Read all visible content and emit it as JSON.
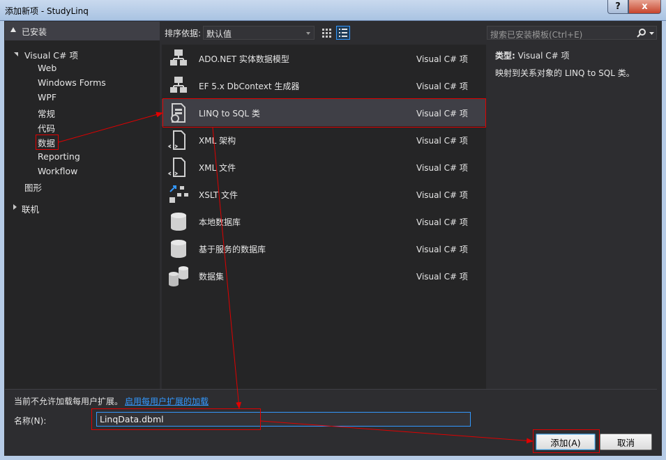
{
  "window": {
    "title": "添加新项 - StudyLinq",
    "help_label": "?",
    "close_label": "x"
  },
  "left_panel": {
    "header": "已安装",
    "tree": [
      {
        "label": "Visual C# 项",
        "level": 0,
        "expanded": true
      },
      {
        "label": "Web",
        "level": 1
      },
      {
        "label": "Windows Forms",
        "level": 1
      },
      {
        "label": "WPF",
        "level": 1
      },
      {
        "label": "常规",
        "level": 1
      },
      {
        "label": "代码",
        "level": 1
      },
      {
        "label": "数据",
        "level": 1,
        "selected": true
      },
      {
        "label": "Reporting",
        "level": 1
      },
      {
        "label": "Workflow",
        "level": 1
      },
      {
        "label": "图形",
        "level": 0
      },
      {
        "label": "联机",
        "level": 0,
        "expanded": false
      }
    ]
  },
  "toolbar": {
    "sort_label": "排序依据:",
    "sort_value": "默认值",
    "search_placeholder": "搜索已安装模板(Ctrl+E)"
  },
  "templates": [
    {
      "name": "ADO.NET 实体数据模型",
      "type": "Visual C# 项",
      "icon": "entity-model-icon"
    },
    {
      "name": "EF 5.x DbContext 生成器",
      "type": "Visual C# 项",
      "icon": "dbcontext-generator-icon"
    },
    {
      "name": "LINQ to SQL 类",
      "type": "Visual C# 项",
      "icon": "linq-to-sql-icon",
      "selected": true
    },
    {
      "name": "XML 架构",
      "type": "Visual C# 项",
      "icon": "xml-schema-icon"
    },
    {
      "name": "XML 文件",
      "type": "Visual C# 项",
      "icon": "xml-file-icon"
    },
    {
      "name": "XSLT 文件",
      "type": "Visual C# 项",
      "icon": "xslt-file-icon"
    },
    {
      "name": "本地数据库",
      "type": "Visual C# 项",
      "icon": "local-database-icon"
    },
    {
      "name": "基于服务的数据库",
      "type": "Visual C# 项",
      "icon": "service-database-icon"
    },
    {
      "name": "数据集",
      "type": "Visual C# 项",
      "icon": "dataset-icon"
    }
  ],
  "detail": {
    "type_label": "类型:",
    "type_value": "Visual C# 项",
    "description": "映射到关系对象的 LINQ to SQL 类。"
  },
  "bottom": {
    "notice": "当前不允许加载每用户扩展。",
    "enable_link": "启用每用户扩展的加载",
    "name_label": "名称(N):",
    "name_value": "LinqData.dbml",
    "add_button": "添加(A)",
    "cancel_button": "取消"
  },
  "colors": {
    "accent": "#3399ff",
    "annotation": "#e00000",
    "selected_row": "#3f3f46"
  }
}
